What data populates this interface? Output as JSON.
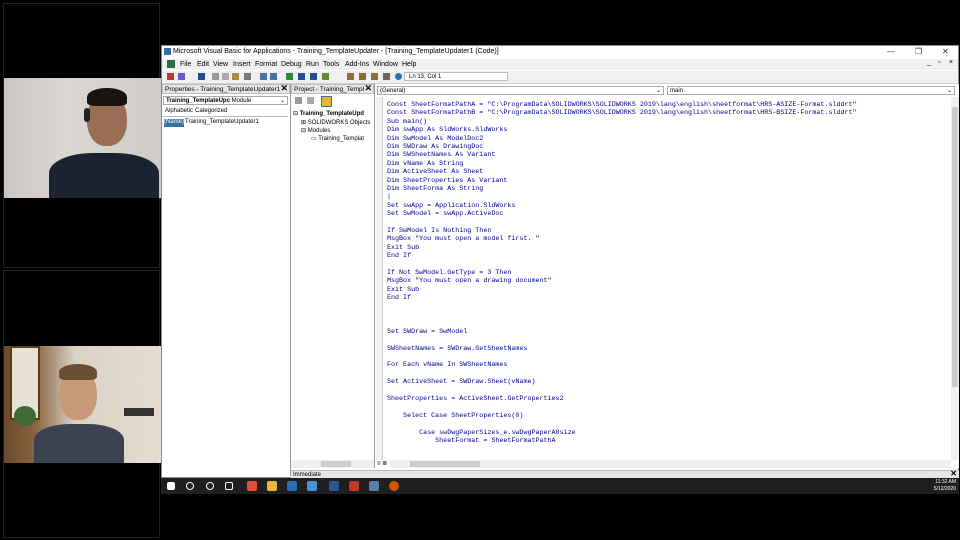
{
  "window": {
    "title": "Microsoft Visual Basic for Applications - Training_TemplateUpdater - [Training_TemplateUpdater1 (Code)]",
    "controls": [
      "—",
      "❐",
      "✕"
    ],
    "inner_controls": [
      "_",
      "▫",
      "×"
    ]
  },
  "menu": [
    "File",
    "Edit",
    "View",
    "Insert",
    "Format",
    "Debug",
    "Run",
    "Tools",
    "Add-Ins",
    "Window",
    "Help"
  ],
  "toolbar": {
    "position": "Ln 13, Col 1"
  },
  "properties": {
    "header": "Properties - Training_TemplateUpdater1",
    "object": "Training_TemplateUpc",
    "object_type": "Module",
    "tabs": [
      "Alphabetic",
      "Categorized"
    ],
    "name_label": "(Name)",
    "name_value": "Training_TemplateUpdater1"
  },
  "project": {
    "header": "Project - Training_Templ",
    "tree": [
      "Training_TemplateUpd",
      "SOLIDWORKS Objects",
      "Modules",
      "Training_Templat"
    ]
  },
  "code": {
    "object_combo": "(General)",
    "proc_combo": "main",
    "lines": [
      "Const SheetFormatPathA = \"C:\\ProgramData\\SOLIDWORKS\\SOLIDWORKS 2019\\lang\\english\\sheetformat\\HRS-ASIZE-Format.slddrt\"",
      "Const SheetFormatPathB = \"C:\\ProgramData\\SOLIDWORKS\\SOLIDWORKS 2019\\lang\\english\\sheetformat\\HRS-BSIZE-Format.slddrt\"",
      "Sub main()",
      "Dim swApp As SldWorks.SldWorks",
      "Dim SwModel As ModelDoc2",
      "Dim SWDraw As DrawingDoc",
      "Dim SWSheetNames As Variant",
      "Dim vName As String",
      "Dim ActiveSheet As Sheet",
      "Dim SheetProperties As Variant",
      "Dim SheetForma As String",
      "|",
      "Set swApp = Application.SldWorks",
      "Set SwModel = swApp.ActiveDoc",
      "",
      "If SwModel Is Nothing Then",
      "MsgBox \"You must open a model first. \"",
      "Exit Sub",
      "End If",
      "",
      "If Not SwModel.GetType = 3 Then",
      "MsgBox \"You must open a drawing document\"",
      "Exit Sub",
      "End If",
      "",
      "",
      "",
      "Set SWDraw = SwModel",
      "",
      "SWSheetNames = SWDraw.GetSheetNames",
      "",
      "For Each vName In SWSheetNames",
      "",
      "Set ActiveSheet = SWDraw.Sheet(vName)",
      "",
      "SheetProperties = ActiveSheet.GetProperties2",
      "",
      "    Select Case SheetProperties(0)",
      "",
      "        Case swDwgPaperSizes_e.swDwgPaperA0size",
      "            SheetFormat = SheetFormatPathA"
    ]
  },
  "immediate_label": "Immediate",
  "clock": {
    "time": "11:32 AM",
    "date": "5/12/2020"
  }
}
